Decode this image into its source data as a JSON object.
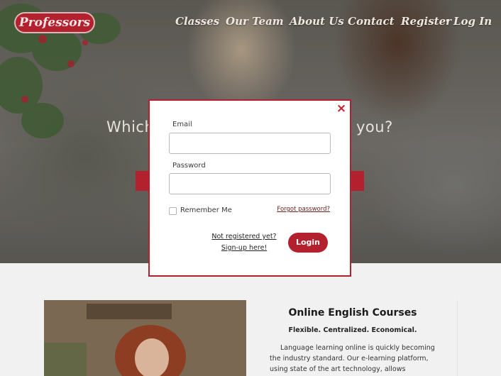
{
  "brand": {
    "logo_text": "Professors"
  },
  "nav": {
    "items": [
      "Classes",
      "Our Team",
      "About Us",
      "Contact",
      "Register",
      "Log In"
    ],
    "separator": "•"
  },
  "hero": {
    "title_left": "Which",
    "title_right": "you?"
  },
  "login_modal": {
    "close_icon": "×",
    "email_label": "Email",
    "email_value": "",
    "password_label": "Password",
    "password_value": "",
    "remember_label": "Remember Me",
    "remember_checked": false,
    "forgot_link": "Forgot password?",
    "signup_line1": "Not registered yet?",
    "signup_line2": "Sign-up here!",
    "login_button": "Login"
  },
  "course": {
    "title": "Online English Courses",
    "subtitle": "Flexible. Centralized. Economical.",
    "body": "Language learning online is quickly becoming the industry standard. Our e-learning platform, using state of the art technology, allows"
  },
  "colors": {
    "brand_red": "#b3202e",
    "modal_border": "#b3202e",
    "close_icon": "#c81d2c"
  }
}
